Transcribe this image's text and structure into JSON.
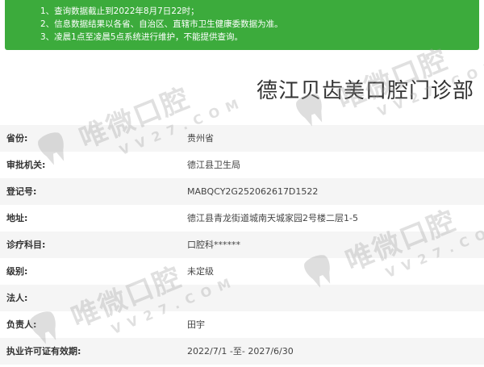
{
  "notice": {
    "lines": [
      "1、查询数据截止到2022年8月7日22时；",
      "2、信息数据结果以各省、自治区、直辖市卫生健康委数据为准。",
      "3、凌晨1点至凌晨5点系统进行维护，不能提供查询。"
    ],
    "bg_color": "#3cab3c"
  },
  "title": "德江贝齿美口腔门诊部",
  "rows": [
    {
      "label": "省份:",
      "value": "贵州省"
    },
    {
      "label": "审批机关:",
      "value": "德江县卫生局"
    },
    {
      "label": "登记号:",
      "value": "MABQCY2G252062617D1522"
    },
    {
      "label": "地址:",
      "value": "德江县青龙街道城南天城家园2号楼二层1-5"
    },
    {
      "label": "诊疗科目:",
      "value": "口腔科******"
    },
    {
      "label": "级别:",
      "value": "未定级"
    },
    {
      "label": "法人:",
      "value": ""
    },
    {
      "label": "负责人:",
      "value": "田宇"
    },
    {
      "label": "执业许可证有效期:",
      "value": "2022/7/1 -至- 2027/6/30"
    }
  ],
  "watermark": {
    "brand": "唯微口腔",
    "domain": "VV27.COM",
    "icon": "tooth-logo-icon"
  }
}
